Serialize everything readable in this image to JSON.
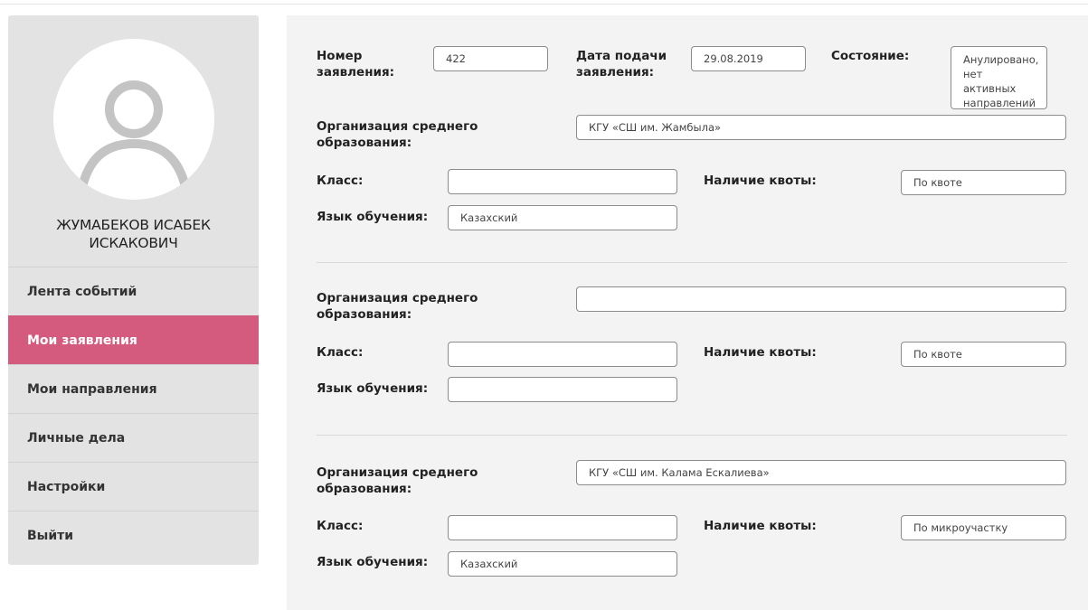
{
  "user": {
    "name_line1": "ЖУМАБЕКОВ ИСАБЕК",
    "name_line2": "ИСКАКОВИЧ",
    "avatar_icon": "user-avatar-icon"
  },
  "menu": {
    "items": [
      {
        "label": "Лента событий"
      },
      {
        "label": "Мои заявления",
        "active": true
      },
      {
        "label": "Мои направления"
      },
      {
        "label": "Личные дела"
      },
      {
        "label": "Настройки"
      },
      {
        "label": "Выйти"
      }
    ]
  },
  "colors": {
    "accent": "#d45b7d",
    "sidebar_bg": "#e3e3e3",
    "panel_bg": "#f3f3f3"
  },
  "application": {
    "number_label_1": "Номер",
    "number_label_2": "заявления:",
    "number_value": "422",
    "date_label_1": "Дата подачи",
    "date_label_2": "заявления:",
    "date_value": "29.08.2019",
    "status_label": "Состояние:",
    "status_line1": "Анулировано,",
    "status_line2": "нет активных",
    "status_line3": "направлений"
  },
  "labels": {
    "org_1": "Организация среднего",
    "org_2": "образования:",
    "class": "Класс:",
    "quota": "Наличие квоты:",
    "language": "Язык обучения:"
  },
  "sections": [
    {
      "org": "КГУ «СШ им. Жамбыла»",
      "class": "",
      "quota": "По квоте",
      "language": "Казахский"
    },
    {
      "org": "",
      "class": "",
      "quota": "По квоте",
      "language": ""
    },
    {
      "org": "КГУ «СШ им. Калама Ескалиева»",
      "class": "",
      "quota": "По микроучастку",
      "language": "Казахский"
    }
  ]
}
